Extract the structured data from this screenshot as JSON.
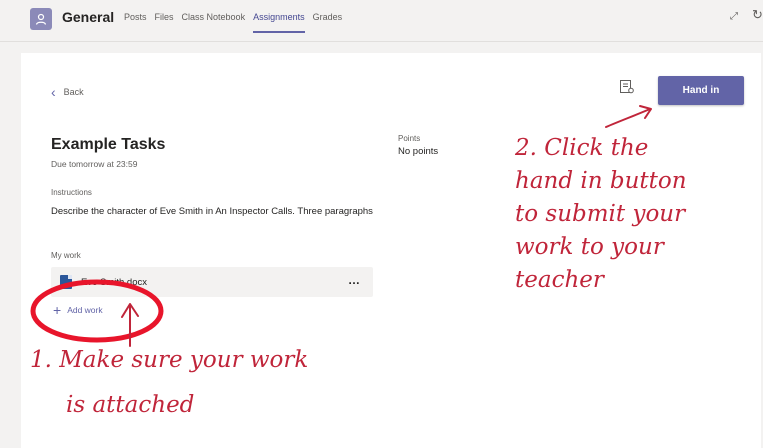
{
  "header": {
    "channel_name": "General",
    "tabs": [
      {
        "label": "Posts",
        "active": false
      },
      {
        "label": "Files",
        "active": false
      },
      {
        "label": "Class Notebook",
        "active": false
      },
      {
        "label": "Assignments",
        "active": true
      },
      {
        "label": "Grades",
        "active": false
      }
    ],
    "icons": [
      "team-avatar-icon",
      "expand-icon",
      "refresh-icon"
    ]
  },
  "assignment": {
    "back_label": "Back",
    "hand_in_label": "Hand in",
    "title": "Example Tasks",
    "due": "Due tomorrow at 23:59",
    "points_label": "Points",
    "points_value": "No points",
    "instructions_label": "Instructions",
    "instructions_text": "Describe the character of Eve Smith in An Inspector Calls. Three paragraphs",
    "my_work_label": "My work",
    "files": [
      {
        "name": "Eve Smith.docx",
        "icon": "word-doc-icon"
      }
    ],
    "add_work_label": "Add work"
  },
  "annotations": {
    "step1": [
      "1. Make sure your work",
      "is attached"
    ],
    "step2": [
      "2. Click the",
      "hand in button",
      "to submit your",
      "work to your",
      "teacher"
    ],
    "color": "#c0253a"
  },
  "colors": {
    "accent": "#6264a7",
    "background": "#f3f2f1",
    "annotation": "#c0253a"
  }
}
